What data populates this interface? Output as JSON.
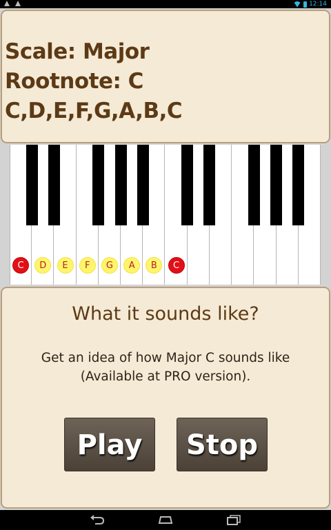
{
  "status_bar": {
    "left_icons": [
      "warning-icon",
      "warning-icon"
    ],
    "right_icons": [
      "wifi-icon",
      "battery-icon"
    ],
    "time": "12:14"
  },
  "scale_info": {
    "scale_line": "Scale: Major",
    "rootnote_line": "Rootnote: C",
    "notes_line": "C,D,E,F,G,A,B,C"
  },
  "keyboard": {
    "white_key_count": 14,
    "highlighted_notes": [
      {
        "label": "C",
        "style": "root"
      },
      {
        "label": "D",
        "style": "scale"
      },
      {
        "label": "E",
        "style": "scale"
      },
      {
        "label": "F",
        "style": "scale"
      },
      {
        "label": "G",
        "style": "scale"
      },
      {
        "label": "A",
        "style": "scale"
      },
      {
        "label": "B",
        "style": "scale"
      },
      {
        "label": "C",
        "style": "root"
      }
    ]
  },
  "sound_section": {
    "title": "What it sounds like?",
    "description_line1": "Get an idea of how Major C sounds like",
    "description_line2": "(Available at PRO version).",
    "play_label": "Play",
    "stop_label": "Stop"
  },
  "colors": {
    "panel_background": "#f5ead5",
    "panel_border": "#b79f7d",
    "heading_text": "#5c3a16",
    "root_note": "#e20f16",
    "scale_note": "#fff56a",
    "button": "#5a4f44"
  },
  "nav_bar": {
    "icons": [
      "back-icon",
      "home-icon",
      "recents-icon"
    ]
  }
}
